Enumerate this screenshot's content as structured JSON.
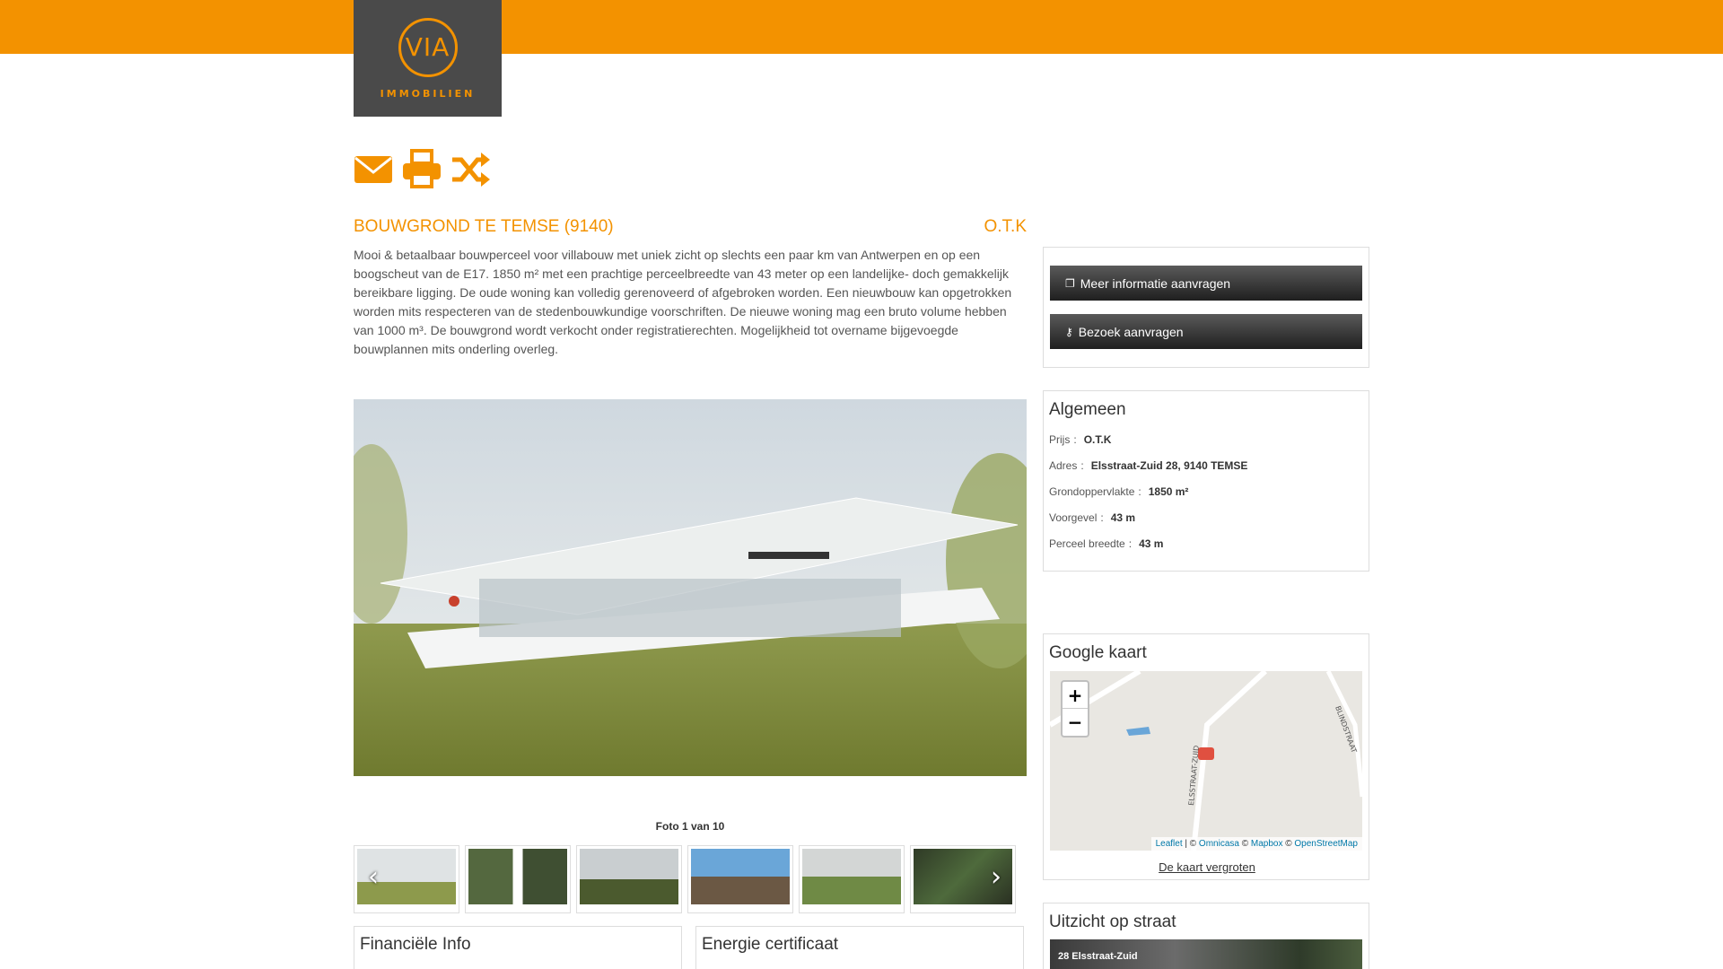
{
  "brand": {
    "logo_mark": "VIA",
    "logo_text": "IMMOBILIEN",
    "color": "#f39200"
  },
  "toolbar_icons": [
    "envelope-icon",
    "print-icon",
    "shuffle-icon"
  ],
  "listing": {
    "title": "BOUWGROND TE TEMSE (9140)",
    "price": "O.T.K",
    "description": "Mooi & betaalbaar bouwperceel voor villabouw met uniek zicht op slechts een paar km van Antwerpen en op een boogscheut van de E17. 1850 m² met een prachtige perceelbreedte van 43 meter op een landelijke- doch gemakkelijk bereikbare ligging. De oude woning kan volledig gerenoveerd of afgebroken worden. Een nieuwbouw kan opgetrokken worden mits respecteren van de stedenbouwkundige voorschriften. De nieuwe woning mag een bruto volume hebben van 1000 m³. De bouwgrond wordt verkocht onder registratierechten. Mogelijkheid tot overname bijgevoegde bouwplannen mits onderling overleg."
  },
  "gallery": {
    "caption": "Foto 1 van 10"
  },
  "actions": {
    "info": "Meer informatie aanvragen",
    "visit": "Bezoek aanvragen"
  },
  "algemeen": {
    "title": "Algemeen",
    "rows": [
      {
        "label": "Prijs",
        "value": "O.T.K"
      },
      {
        "label": "Adres",
        "value": "Elsstraat-Zuid 28, 9140 TEMSE"
      },
      {
        "label": "Grondoppervlakte",
        "value": "1850 m²"
      },
      {
        "label": "Voorgevel",
        "value": "43 m"
      },
      {
        "label": "Perceel breedte",
        "value": "43 m"
      }
    ],
    "separator": ":"
  },
  "kaart": {
    "title": "Google kaart",
    "zoom_in": "+",
    "zoom_out": "−",
    "attribution_leaflet": "Leaflet",
    "attribution_sep": " | © ",
    "attribution_omnicasa": "Omnicasa",
    "attribution_copy": " © ",
    "attribution_mapbox": "Mapbox",
    "attribution_osm": "OpenStreetMap",
    "street_1": "ELSSTRAAT-ZUID",
    "street_2": "BLINDSTRAAT",
    "enlarge_link": "De kaart vergroten"
  },
  "straat": {
    "title": "Uitzicht op straat",
    "label": "28 Elsstraat-Zuid"
  },
  "financieel": {
    "title": "Financiële Info"
  },
  "energie": {
    "title": "Energie certificaat"
  }
}
